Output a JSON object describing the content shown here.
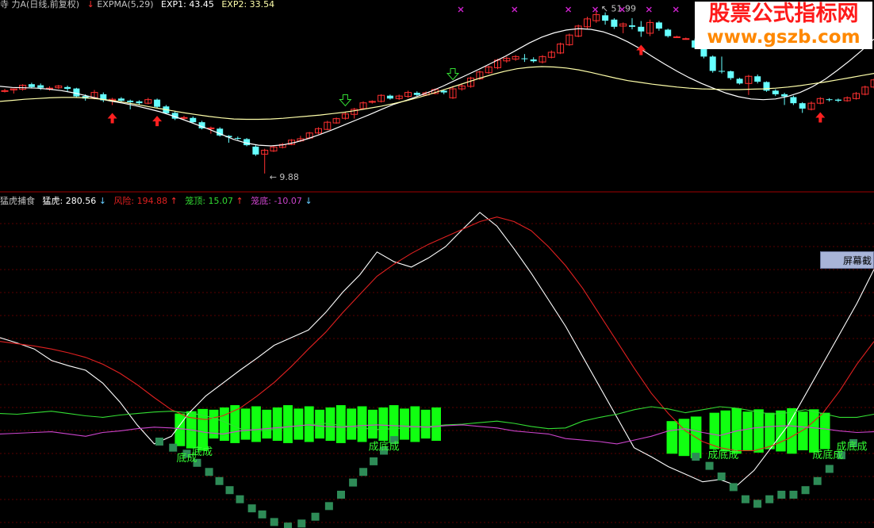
{
  "header_top": {
    "prefix": "寺 力A(日线,前复权)",
    "arrow": "↓",
    "ind": "EXPMA(5,29)",
    "exp1": "EXP1: 43.45",
    "exp2": "EXP2: 33.54"
  },
  "header_bottom": {
    "name": "猛虎捕食",
    "menghu": "猛虎: 280.56",
    "menghu_arrow": "↓",
    "fengxian": "风险: 194.88",
    "fengxian_arrow": "↑",
    "longding": "笼顶: 15.07",
    "longding_arrow": "↑",
    "longdi": "笼底: -10.07",
    "longdi_arrow": "↓"
  },
  "watermark": {
    "line1": "股票公式指标网",
    "line2": "www.gszb.com"
  },
  "screenshot_button": "屏幕截图",
  "colors": {
    "up": "#ff3030",
    "down": "#66ffff",
    "exp1": "#ffffff",
    "exp2": "#ffffaa",
    "menghu": "#ffffff",
    "fengxian": "#e02020",
    "longding": "#33dd33",
    "longdi": "#cc44cc",
    "bar": "#11ff11",
    "square": "#2e8b57",
    "marker": "#cc22cc"
  },
  "chart_data": [
    {
      "type": "candlestick",
      "title": "EXPMA(5,29)",
      "price_min": 7.0,
      "price_max": 56.5,
      "candles": [
        [
          33.0,
          33.0,
          33.5,
          32.5
        ],
        [
          33.2,
          33.5,
          33.6,
          32.2
        ],
        [
          33.4,
          34.5,
          34.8,
          33.0
        ],
        [
          34.8,
          34.0,
          35.2,
          33.6
        ],
        [
          34.5,
          33.8,
          35.0,
          33.2
        ],
        [
          33.5,
          33.7,
          34.2,
          33.0
        ],
        [
          33.8,
          34.3,
          34.6,
          33.5
        ],
        [
          34.0,
          33.5,
          34.4,
          32.8
        ],
        [
          33.6,
          31.4,
          33.8,
          31.0
        ],
        [
          31.5,
          30.8,
          32.0,
          30.2
        ],
        [
          31.0,
          32.5,
          33.2,
          30.6
        ],
        [
          32.0,
          30.3,
          32.5,
          29.8
        ],
        [
          30.3,
          30.6,
          31.0,
          29.0
        ],
        [
          30.8,
          30.2,
          31.2,
          29.8
        ],
        [
          30.2,
          29.8,
          30.5,
          27.8
        ],
        [
          30.0,
          29.5,
          30.3,
          29.0
        ],
        [
          29.5,
          30.5,
          31.0,
          29.2
        ],
        [
          30.5,
          28.5,
          30.8,
          28.2
        ],
        [
          28.6,
          26.7,
          29.0,
          26.5
        ],
        [
          26.8,
          25.2,
          27.2,
          24.8
        ],
        [
          25.3,
          25.5,
          26.0,
          25.0
        ],
        [
          25.4,
          24.2,
          25.8,
          23.9
        ],
        [
          24.2,
          22.5,
          24.6,
          22.2
        ],
        [
          22.4,
          22.6,
          23.0,
          21.0
        ],
        [
          22.4,
          20.5,
          22.8,
          20.2
        ],
        [
          20.4,
          20.0,
          20.6,
          18.5
        ],
        [
          19.8,
          19.7,
          20.2,
          19.3
        ],
        [
          19.5,
          17.8,
          19.8,
          17.5
        ],
        [
          17.4,
          15.2,
          17.8,
          14.8
        ],
        [
          15.3,
          16.4,
          16.8,
          9.9
        ],
        [
          16.2,
          17.3,
          17.6,
          15.9
        ],
        [
          17.2,
          18.0,
          18.4,
          16.9
        ],
        [
          18.0,
          19.2,
          19.5,
          17.8
        ],
        [
          19.0,
          19.6,
          20.4,
          18.7
        ],
        [
          19.8,
          21.2,
          21.5,
          19.5
        ],
        [
          21.2,
          22.4,
          22.8,
          20.9
        ],
        [
          22.2,
          24.2,
          24.6,
          22.0
        ],
        [
          24.0,
          25.2,
          25.5,
          23.8
        ],
        [
          25.3,
          26.5,
          27.0,
          24.9
        ],
        [
          26.4,
          27.8,
          28.2,
          25.2
        ],
        [
          28.0,
          29.6,
          30.0,
          27.7
        ],
        [
          29.8,
          30.0,
          30.3,
          29.4
        ],
        [
          30.0,
          31.7,
          32.0,
          29.7
        ],
        [
          31.6,
          30.8,
          31.9,
          30.5
        ],
        [
          30.8,
          31.5,
          31.9,
          30.4
        ],
        [
          31.4,
          32.5,
          33.0,
          31.0
        ],
        [
          32.4,
          31.8,
          32.8,
          31.5
        ],
        [
          31.8,
          32.4,
          32.8,
          31.5
        ],
        [
          32.2,
          33.3,
          33.6,
          32.0
        ],
        [
          33.0,
          32.5,
          33.4,
          32.0
        ],
        [
          31.0,
          33.5,
          34.3,
          30.7
        ],
        [
          33.5,
          34.3,
          34.8,
          33.0
        ],
        [
          34.2,
          36.5,
          36.9,
          33.8
        ],
        [
          36.3,
          38.2,
          38.6,
          36.0
        ],
        [
          38.0,
          39.6,
          40.0,
          37.7
        ],
        [
          39.4,
          41.5,
          41.9,
          39.0
        ],
        [
          41.3,
          42.0,
          42.5,
          40.8
        ],
        [
          41.8,
          42.5,
          42.9,
          41.3
        ],
        [
          42.0,
          41.8,
          43.2,
          41.0
        ],
        [
          41.7,
          41.2,
          42.3,
          40.8
        ],
        [
          41.0,
          42.5,
          42.9,
          40.6
        ],
        [
          42.3,
          43.7,
          44.2,
          42.0
        ],
        [
          43.5,
          46.0,
          46.4,
          43.2
        ],
        [
          45.8,
          48.5,
          48.9,
          45.5
        ],
        [
          48.2,
          51.0,
          51.4,
          47.9
        ],
        [
          50.8,
          53.0,
          53.6,
          50.2
        ],
        [
          52.5,
          54.2,
          55.5,
          51.9
        ],
        [
          54.0,
          52.5,
          54.8,
          51.4
        ],
        [
          52.8,
          50.8,
          53.2,
          50.2
        ],
        [
          51.0,
          51.6,
          52.0,
          49.0
        ],
        [
          51.2,
          50.8,
          53.2,
          50.1
        ],
        [
          50.8,
          49.5,
          52.4,
          48.0
        ],
        [
          49.0,
          52.0,
          52.8,
          48.2
        ],
        [
          52.0,
          50.3,
          52.4,
          49.7
        ],
        [
          50.0,
          48.2,
          50.3,
          47.8
        ],
        [
          48.0,
          48.0,
          48.3,
          47.7
        ],
        [
          47.5,
          47.5,
          47.8,
          47.2
        ],
        [
          47.0,
          45.0,
          47.5,
          44.6
        ],
        [
          44.8,
          42.5,
          45.2,
          42.0
        ],
        [
          42.5,
          38.5,
          42.8,
          38.0
        ],
        [
          38.5,
          38.3,
          42.5,
          37.8
        ],
        [
          38.4,
          36.5,
          38.6,
          36.0
        ],
        [
          36.3,
          35.0,
          36.6,
          34.7
        ],
        [
          35.0,
          37.0,
          37.4,
          31.8
        ],
        [
          37.0,
          35.5,
          37.5,
          35.0
        ],
        [
          35.4,
          33.0,
          35.6,
          32.7
        ],
        [
          33.0,
          32.0,
          33.4,
          31.5
        ],
        [
          32.0,
          31.4,
          32.4,
          29.0
        ],
        [
          31.2,
          29.5,
          31.6,
          29.0
        ],
        [
          29.5,
          28.0,
          29.8,
          26.8
        ],
        [
          27.8,
          29.5,
          30.0,
          27.5
        ],
        [
          29.5,
          30.8,
          31.2,
          29.2
        ],
        [
          30.6,
          30.4,
          30.9,
          30.0
        ],
        [
          30.5,
          30.2,
          30.8,
          29.8
        ],
        [
          30.2,
          31.0,
          31.4,
          29.9
        ],
        [
          30.8,
          32.2,
          32.6,
          30.5
        ],
        [
          32.0,
          34.0,
          34.4,
          31.7
        ],
        [
          34.0,
          36.0,
          36.4,
          33.6
        ],
        [
          36.0,
          36.2,
          36.6,
          35.5
        ],
        [
          36.2,
          37.5,
          37.8,
          35.9
        ],
        [
          37.4,
          40.0,
          40.4,
          37.0
        ],
        [
          40.0,
          43.5,
          43.9,
          39.6
        ],
        [
          43.5,
          46.0,
          46.4,
          43.0
        ],
        [
          45.8,
          49.0,
          49.4,
          45.5
        ],
        [
          49.0,
          51.5,
          52.0,
          48.5
        ],
        [
          51.2,
          53.0,
          53.5,
          50.9
        ]
      ],
      "exp1": [
        34.2,
        33.9,
        33.8,
        33.7,
        33.4,
        33.0,
        32.4,
        31.6,
        30.8,
        30.1,
        29.5,
        28.8,
        28.0,
        27.1,
        26.0,
        24.8,
        23.5,
        22.2,
        20.8,
        19.4,
        18.4,
        17.8,
        17.6,
        17.9,
        18.6,
        19.6,
        20.8,
        22.1,
        23.5,
        24.9,
        26.3,
        27.8,
        29.2,
        30.3,
        31.5,
        32.8,
        34.3,
        35.9,
        37.5,
        39.1,
        40.8,
        42.5,
        44.4,
        46.3,
        47.9,
        49.1,
        49.9,
        50.3,
        50.1,
        49.4,
        48.2,
        46.6,
        44.7,
        42.5,
        40.4,
        38.4,
        36.6,
        35.0,
        33.6,
        32.3,
        31.3,
        30.7,
        30.5,
        30.7,
        31.4,
        32.5,
        34.1,
        36.1,
        38.6,
        41.3,
        44.2,
        47.4
      ],
      "exp2": [
        30.0,
        30.3,
        30.6,
        30.8,
        31.0,
        31.1,
        31.1,
        31.0,
        30.7,
        30.3,
        29.8,
        29.2,
        28.6,
        28.0,
        27.4,
        26.8,
        26.3,
        25.8,
        25.4,
        25.1,
        25.0,
        25.0,
        25.1,
        25.3,
        25.6,
        25.9,
        26.2,
        26.6,
        27.0,
        27.5,
        28.1,
        28.7,
        29.4,
        30.2,
        31.1,
        32.1,
        33.2,
        34.3,
        35.4,
        36.5,
        37.5,
        38.4,
        39.1,
        39.5,
        39.7,
        39.6,
        39.3,
        38.8,
        38.1,
        37.3,
        36.5,
        35.8,
        35.3,
        34.8,
        34.4,
        34.0,
        33.7,
        33.5,
        33.4,
        33.3,
        33.3,
        33.4,
        33.5,
        33.7,
        34.0,
        34.4,
        34.9,
        35.4,
        36.0,
        36.6,
        37.2,
        37.8
      ],
      "annotations": [
        {
          "text": "51.99",
          "at_index": 66
        },
        {
          "text": "9.88",
          "at_index": 29
        }
      ],
      "buy_signals": [
        12,
        17,
        71,
        91
      ],
      "sell_signals": [
        38,
        50
      ],
      "top_markers": [
        50,
        56,
        62,
        65,
        68,
        71,
        74,
        77,
        80,
        89,
        94
      ]
    },
    {
      "type": "indicator",
      "title": "猛虎捕食",
      "y_min": -60,
      "y_max": 280,
      "series": [
        {
          "name": "猛虎",
          "values": [
            115,
            108,
            100,
            85,
            78,
            72,
            55,
            30,
            0,
            -25,
            -15,
            15,
            38,
            55,
            72,
            88,
            105,
            115,
            125,
            148,
            175,
            198,
            228,
            215,
            208,
            220,
            235,
            258,
            280,
            262,
            232,
            200,
            165,
            130,
            90,
            50,
            10,
            -30,
            -42,
            -55,
            -65,
            -75,
            -72,
            -80,
            -60,
            -30,
            0,
            40,
            80,
            120,
            160,
            205
          ]
        },
        {
          "name": "风险",
          "values": [
            110,
            107,
            104,
            100,
            95,
            89,
            80,
            68,
            53,
            36,
            20,
            10,
            7,
            12,
            22,
            38,
            56,
            77,
            100,
            122,
            148,
            172,
            196,
            212,
            226,
            238,
            248,
            258,
            268,
            274,
            268,
            256,
            235,
            210,
            180,
            145,
            110,
            75,
            42,
            15,
            -8,
            -22,
            -30,
            -34,
            -34,
            -28,
            -18,
            -5,
            15,
            45,
            80,
            110
          ]
        },
        {
          "name": "笼顶",
          "values": [
            15,
            14,
            16,
            18,
            15,
            12,
            10,
            13,
            15,
            17,
            18,
            16,
            12,
            5,
            -5,
            -8,
            -6,
            -2,
            0,
            2,
            -1,
            -4,
            -6,
            -5,
            -3,
            -2,
            0,
            1,
            3,
            5,
            2,
            -2,
            -5,
            -4,
            5,
            10,
            14,
            20,
            24,
            21,
            16,
            20,
            24,
            22,
            18,
            14,
            16,
            20,
            15,
            10,
            10,
            14
          ]
        },
        {
          "name": "笼底",
          "values": [
            -12,
            -11,
            -10,
            -9,
            -12,
            -15,
            -10,
            -8,
            -5,
            -3,
            -4,
            -6,
            -10,
            -12,
            -8,
            -6,
            -4,
            -2,
            0,
            -2,
            -3,
            -1,
            0,
            -1,
            -2,
            -3,
            -1,
            0,
            -2,
            -4,
            -8,
            -10,
            -12,
            -18,
            -20,
            -22,
            -25,
            -20,
            -15,
            -8,
            -5,
            -10,
            -14,
            -8,
            -4,
            -2,
            -1,
            -3,
            -5,
            -8,
            -10,
            -9
          ]
        }
      ],
      "bars": [
        {
          "from": 10.2,
          "to": 12.2,
          "top": 15,
          "bottom": -28
        },
        {
          "from": 12.2,
          "to": 25.8,
          "top": 20,
          "bottom": -18
        },
        {
          "from": 38.9,
          "to": 41.0,
          "top": 5,
          "bottom": -38
        },
        {
          "from": 41.4,
          "to": 48.5,
          "top": 16,
          "bottom": -32
        }
      ],
      "squares": [
        {
          "x": 9.3,
          "y": -22
        },
        {
          "x": 10.1,
          "y": -30
        },
        {
          "x": 10.9,
          "y": -38
        },
        {
          "x": 11.5,
          "y": -50
        },
        {
          "x": 12.2,
          "y": -62
        },
        {
          "x": 12.8,
          "y": -74
        },
        {
          "x": 13.4,
          "y": -86
        },
        {
          "x": 14.0,
          "y": -98
        },
        {
          "x": 14.7,
          "y": -110
        },
        {
          "x": 15.3,
          "y": -118
        },
        {
          "x": 16.0,
          "y": -128
        },
        {
          "x": 16.8,
          "y": -134
        },
        {
          "x": 17.6,
          "y": -130
        },
        {
          "x": 18.4,
          "y": -121
        },
        {
          "x": 19.2,
          "y": -107
        },
        {
          "x": 19.9,
          "y": -92
        },
        {
          "x": 20.6,
          "y": -76
        },
        {
          "x": 21.2,
          "y": -62
        },
        {
          "x": 21.8,
          "y": -48
        },
        {
          "x": 22.4,
          "y": -34
        },
        {
          "x": 23.0,
          "y": -20
        },
        {
          "x": 40.6,
          "y": -42
        },
        {
          "x": 41.4,
          "y": -54
        },
        {
          "x": 42.1,
          "y": -68
        },
        {
          "x": 42.8,
          "y": -82
        },
        {
          "x": 43.5,
          "y": -98
        },
        {
          "x": 44.2,
          "y": -104
        },
        {
          "x": 44.9,
          "y": -98
        },
        {
          "x": 45.6,
          "y": -92
        },
        {
          "x": 46.3,
          "y": -92
        },
        {
          "x": 47.0,
          "y": -86
        },
        {
          "x": 47.7,
          "y": -74
        },
        {
          "x": 48.4,
          "y": -58
        },
        {
          "x": 49.1,
          "y": -40
        },
        {
          "x": 49.8,
          "y": -24
        }
      ],
      "labels": [
        {
          "text": "底成",
          "x": 11.2,
          "y": -40
        },
        {
          "text": "底成",
          "x": 10.3,
          "y": -48
        },
        {
          "text": "成底成",
          "x": 21.5,
          "y": -33
        },
        {
          "text": "成底成",
          "x": 41.3,
          "y": -44
        },
        {
          "text": "成底成",
          "x": 47.4,
          "y": -44
        },
        {
          "text": "成底成",
          "x": 48.8,
          "y": -33
        }
      ]
    }
  ]
}
